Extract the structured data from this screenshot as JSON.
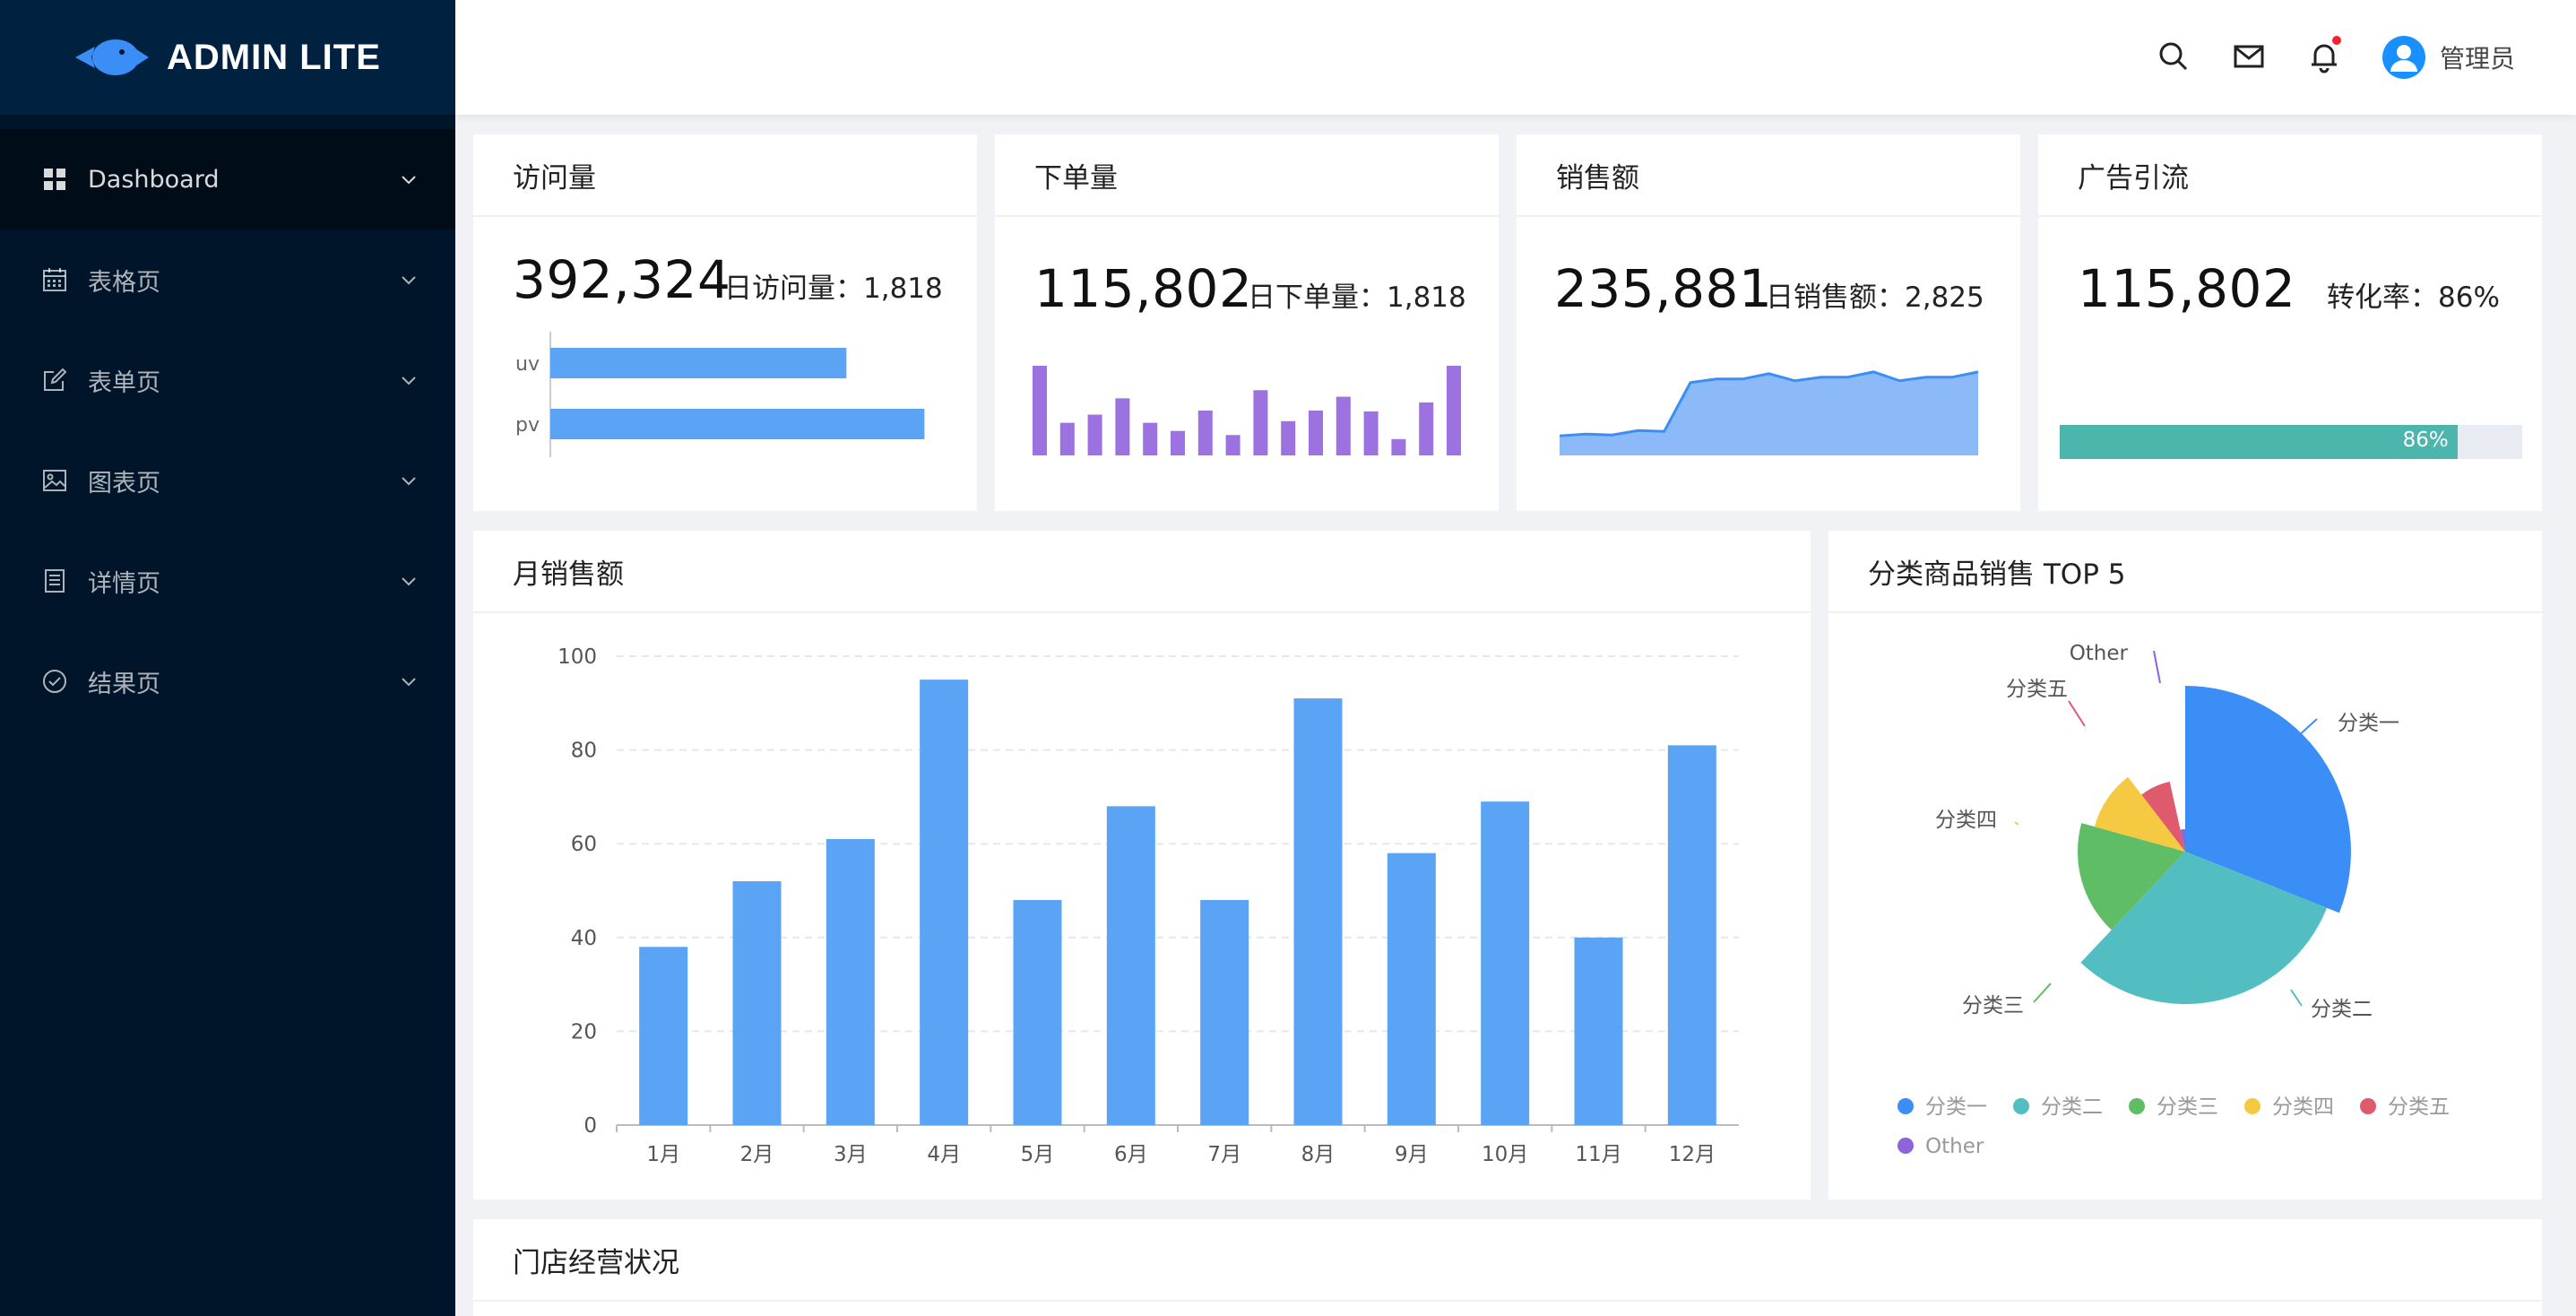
{
  "app": {
    "title": "ADMIN LITE"
  },
  "sidebar": {
    "items": [
      {
        "label": "Dashboard",
        "icon": "dashboard-icon",
        "active": true
      },
      {
        "label": "表格页",
        "icon": "calendar-table-icon"
      },
      {
        "label": "表单页",
        "icon": "edit-form-icon"
      },
      {
        "label": "图表页",
        "icon": "image-chart-icon"
      },
      {
        "label": "详情页",
        "icon": "detail-doc-icon"
      },
      {
        "label": "结果页",
        "icon": "check-circle-icon"
      }
    ]
  },
  "header": {
    "icons": [
      "search-icon",
      "mail-icon",
      "bell-icon"
    ],
    "user_name": "管理员",
    "notification_dot_color": "#f5222d"
  },
  "cards": {
    "visits": {
      "title": "访问量",
      "total": "392,324",
      "daily_label": "日访问量：",
      "daily_value": "1,818"
    },
    "orders": {
      "title": "下单量",
      "total": "115,802",
      "daily_label": "日下单量：",
      "daily_value": "1,818"
    },
    "sales": {
      "title": "销售额",
      "total": "235,881",
      "daily_label": "日销售额：",
      "daily_value": "2,825"
    },
    "ads": {
      "title": "广告引流",
      "total": "115,802",
      "rate_label": "转化率：",
      "rate_value": "86%",
      "progress_label": "86%",
      "progress": 0.86
    }
  },
  "monthly": {
    "title": "月销售额"
  },
  "top5": {
    "title": "分类商品销售 TOP 5"
  },
  "stores": {
    "title": "门店经营状况"
  },
  "colors": {
    "sidebar_bg": "#001529",
    "primary_blue": "#3a8ef6",
    "bar_blue": "#5ba4f5",
    "purple": "#9b72e0",
    "teal": "#4db6ac"
  },
  "chart_data": [
    {
      "type": "bar",
      "orientation": "horizontal",
      "categories": [
        "uv",
        "pv"
      ],
      "values": [
        800,
        1000
      ],
      "color": "#5ba4f5"
    },
    {
      "type": "bar",
      "values": [
        11,
        4,
        5,
        7,
        4,
        3,
        5.5,
        2.5,
        8,
        4.2,
        5.5,
        7.2,
        5.4,
        2,
        6.5,
        11
      ],
      "color": "#9b72e0"
    },
    {
      "type": "area",
      "values": [
        1,
        1.1,
        1.05,
        1.3,
        1.25,
        4.0,
        4.2,
        4.2,
        4.5,
        4.1,
        4.3,
        4.3,
        4.6,
        4.1,
        4.3,
        4.3,
        4.6
      ],
      "color": "#6ea8f7"
    },
    {
      "type": "bar",
      "title": "月销售额",
      "categories": [
        "1月",
        "2月",
        "3月",
        "4月",
        "5月",
        "6月",
        "7月",
        "8月",
        "9月",
        "10月",
        "11月",
        "12月"
      ],
      "values": [
        38,
        52,
        61,
        95,
        48,
        68,
        48,
        91,
        58,
        69,
        40,
        81
      ],
      "ylim": [
        0,
        100
      ],
      "yticks": [
        0,
        20,
        40,
        60,
        80,
        100
      ],
      "grid": true,
      "color": "#5ba4f5"
    },
    {
      "type": "pie",
      "subtype": "rose",
      "title": "分类商品销售 TOP 5",
      "legend_position": "bottom",
      "slices": [
        {
          "name": "分类一",
          "value": 25,
          "radius": 185,
          "color": "#3a8ef6"
        },
        {
          "name": "分类二",
          "value": 25,
          "radius": 170,
          "color": "#53bec2"
        },
        {
          "name": "分类三",
          "value": 13.9,
          "radius": 120,
          "color": "#5fbd66"
        },
        {
          "name": "分类四",
          "value": 8.3,
          "radius": 105,
          "color": "#f5c942"
        },
        {
          "name": "分类五",
          "value": 5.6,
          "radius": 80,
          "color": "#e05a6d"
        },
        {
          "name": "Other",
          "value": 2.8,
          "radius": 25,
          "color": "#8f63d9"
        }
      ]
    }
  ]
}
